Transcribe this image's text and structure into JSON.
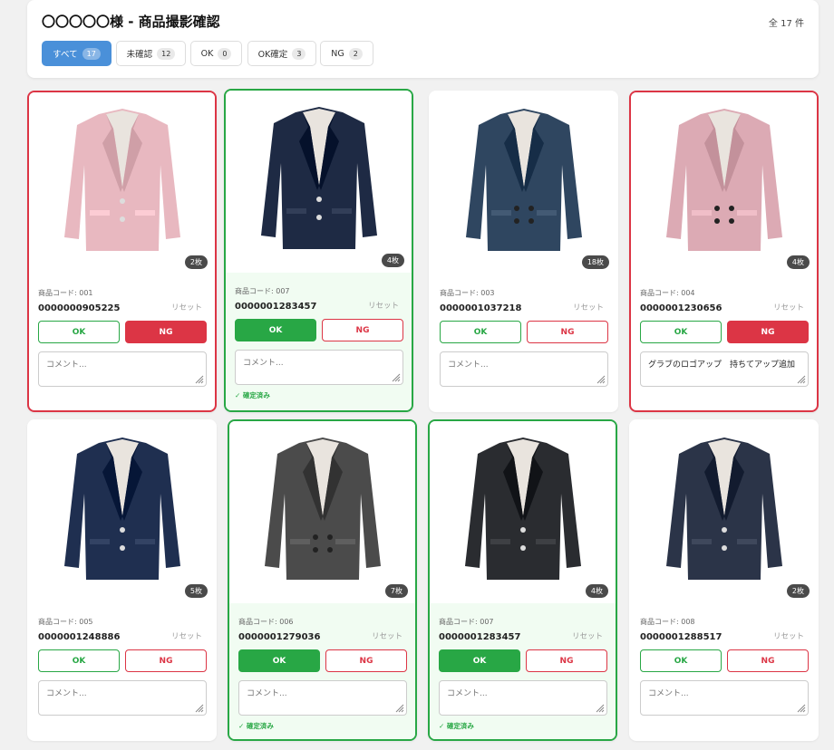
{
  "header": {
    "title": "〇〇〇〇〇様 - 商品撮影確認",
    "total": "全 17 件",
    "tabs": [
      {
        "label": "すべて",
        "count": "17"
      },
      {
        "label": "未確認",
        "count": "12"
      },
      {
        "label": "OK",
        "count": "0"
      },
      {
        "label": "OK確定",
        "count": "3"
      },
      {
        "label": "NG",
        "count": "2"
      }
    ]
  },
  "card_common": {
    "code_label_prefix": "商品コード:",
    "reset_label": "リセット",
    "ok_label": "OK",
    "ng_label": "NG",
    "comment_placeholder": "コメント...",
    "confirmed_label": "✓ 確定済み"
  },
  "cards": [
    {
      "code_label": "商品コード: 001",
      "code_value": "0000000905225",
      "image_count": "2枚",
      "status": "NG",
      "comment": "",
      "jacket_color": "#e8b8c0",
      "jacket_type": "single"
    },
    {
      "code_label": "商品コード: 007",
      "code_value": "0000001283457",
      "image_count": "4枚",
      "status": "OK確定",
      "comment": "",
      "jacket_color": "#1e2a44",
      "jacket_type": "single"
    },
    {
      "code_label": "商品コード: 003",
      "code_value": "0000001037218",
      "image_count": "18枚",
      "status": "未確認",
      "comment": "",
      "jacket_color": "#2f4660",
      "jacket_type": "double"
    },
    {
      "code_label": "商品コード: 004",
      "code_value": "0000001230656",
      "image_count": "4枚",
      "status": "NG",
      "comment": "グラブのロゴアップ　持ちてアップ追加",
      "jacket_color": "#dcaab4",
      "jacket_type": "double"
    },
    {
      "code_label": "商品コード: 005",
      "code_value": "0000001248886",
      "image_count": "5枚",
      "status": "未確認",
      "comment": "",
      "jacket_color": "#1f2f50",
      "jacket_type": "single"
    },
    {
      "code_label": "商品コード: 006",
      "code_value": "0000001279036",
      "image_count": "7枚",
      "status": "OK確定",
      "comment": "",
      "jacket_color": "#4b4b4b",
      "jacket_type": "double"
    },
    {
      "code_label": "商品コード: 007",
      "code_value": "0000001283457",
      "image_count": "4枚",
      "status": "OK確定",
      "comment": "",
      "jacket_color": "#2a2c30",
      "jacket_type": "single"
    },
    {
      "code_label": "商品コード: 008",
      "code_value": "0000001288517",
      "image_count": "2枚",
      "status": "未確認",
      "comment": "",
      "jacket_color": "#2b3448",
      "jacket_type": "single"
    }
  ],
  "colors": {
    "accent": "#4a90d9",
    "ok": "#28a745",
    "ng": "#dc3545",
    "confirmed_bg": "#f1fcf2"
  }
}
